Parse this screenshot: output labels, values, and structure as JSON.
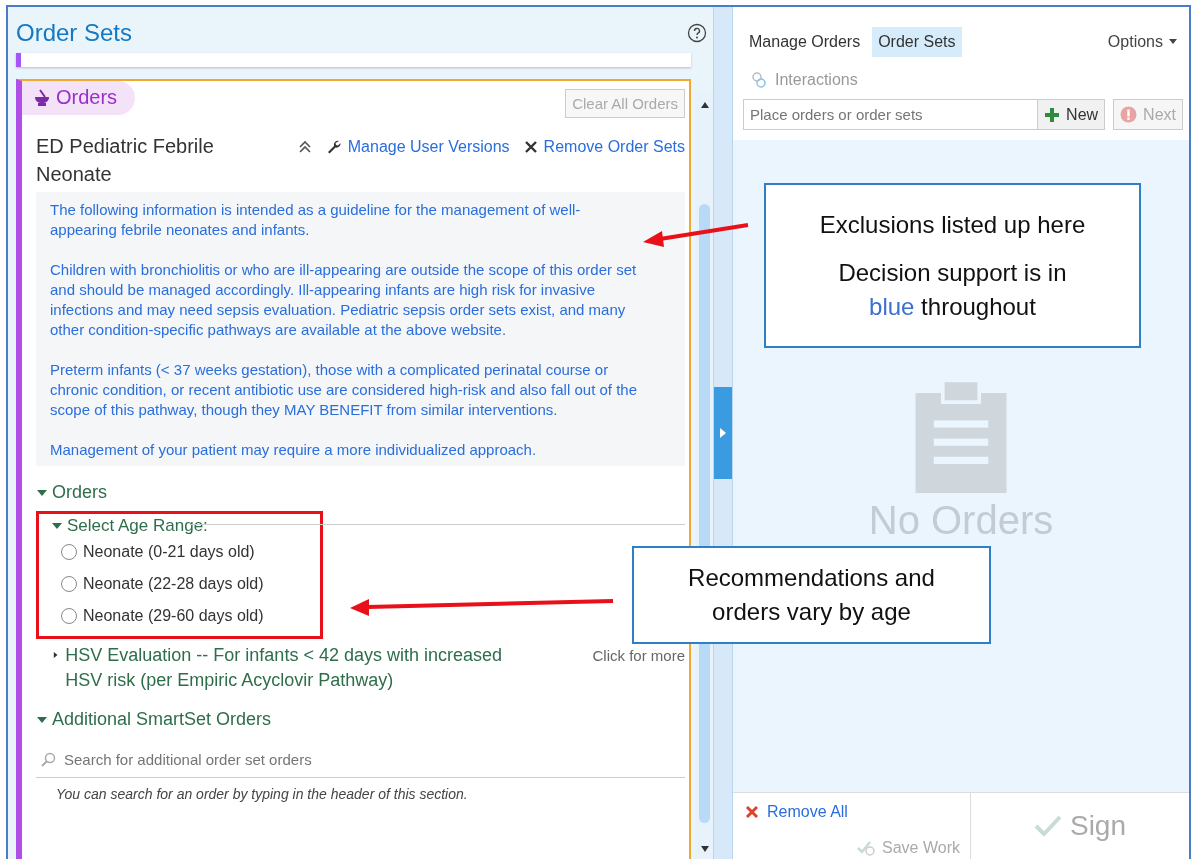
{
  "left_panel": {
    "title": "Order Sets",
    "section_badge": "Orders",
    "clear_button": "Clear All Orders",
    "order_set": {
      "title": "ED Pediatric Febrile Neonate",
      "actions": [
        {
          "kind": "collapse"
        },
        {
          "kind": "wrench",
          "label": "Manage User Versions"
        },
        {
          "kind": "remove",
          "label": "Remove Order Sets"
        }
      ],
      "info": [
        "The following information is intended as a guideline for the management of well-appearing febrile neonates and infants.",
        "Children with bronchiolitis or who are ill-appearing are outside the scope of this order set and should be managed accordingly. Ill-appearing infants are high risk for invasive infections and may need sepsis evaluation. Pediatric sepsis order sets exist, and many other condition-specific pathways are available at the above website.",
        "Preterm infants (< 37 weeks gestation), those with a complicated perinatal course or chronic condition, or recent antibiotic use are considered high-risk and also fall out of the scope of this pathway, though they MAY BENEFIT from similar interventions.",
        "Management of your patient may require a more individualized approach."
      ]
    },
    "orders_section": {
      "label": "Orders",
      "expanded": true,
      "age_group": {
        "label": "Select Age Range:",
        "expanded": true,
        "options": [
          {
            "label": "Neonate (0-21 days old)",
            "selected": false
          },
          {
            "label": "Neonate (22-28 days old)",
            "selected": false
          },
          {
            "label": "Neonate (29-60 days old)",
            "selected": false
          }
        ]
      },
      "hsv": {
        "label": "HSV Evaluation -- For infants < 42 days with increased HSV risk (per Empiric Acyclovir Pathway)",
        "expanded": false,
        "hint": "Click for more"
      }
    },
    "additional_section": {
      "label": "Additional SmartSet Orders",
      "expanded": true,
      "search_placeholder": "Search for additional order set orders",
      "note": "You can search for an order by typing in the header of this section."
    }
  },
  "right_panel": {
    "tabs": [
      {
        "label": "Manage Orders",
        "selected": false
      },
      {
        "label": "Order Sets",
        "selected": true
      }
    ],
    "options": "Options",
    "interactions": "Interactions",
    "order_placeholder": "Place orders or order sets",
    "new_button": "New",
    "next_button": "Next",
    "empty_text": "No Orders",
    "remove_all": "Remove All",
    "save_work": "Save Work",
    "sign": "Sign"
  },
  "annotations": [
    {
      "lines": [
        "Exclusions listed up here"
      ],
      "support": {
        "before": "Decision support is in",
        "highlight": "blue",
        "after": "throughout"
      }
    },
    {
      "lines": [
        "Recommendations and",
        "orders vary by age"
      ]
    }
  ]
}
